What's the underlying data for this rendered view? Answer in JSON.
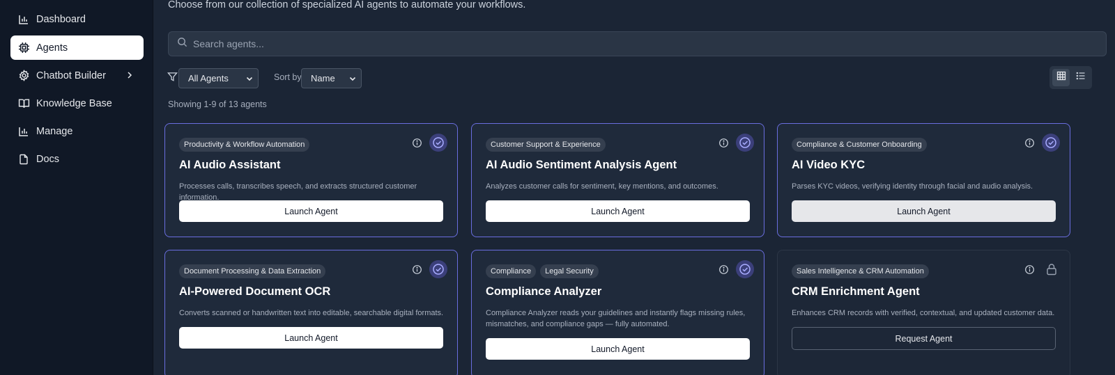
{
  "sidebar": {
    "items": [
      {
        "label": "Dashboard",
        "icon": "bar-chart-icon"
      },
      {
        "label": "Agents",
        "icon": "cpu-icon",
        "active": true
      },
      {
        "label": "Chatbot Builder",
        "icon": "gear-icon"
      },
      {
        "label": "Knowledge Base",
        "icon": "book-icon"
      },
      {
        "label": "Manage",
        "icon": "bar-chart-icon"
      },
      {
        "label": "Docs",
        "icon": "file-icon"
      }
    ]
  },
  "header": {
    "subtitle": "Choose from our collection of specialized AI agents to automate your workflows."
  },
  "search": {
    "placeholder": "Search agents..."
  },
  "filters": {
    "category_value": "All Agents",
    "sort_label": "Sort by:",
    "sort_value": "Name",
    "showing": "Showing 1-9 of 13 agents"
  },
  "agents": [
    {
      "tags": [
        "Productivity & Workflow Automation"
      ],
      "title": "AI Audio Assistant",
      "description": "Processes calls, transcribes speech, and extracts structured customer information.",
      "button": "Launch Agent",
      "status": "enabled"
    },
    {
      "tags": [
        "Customer Support & Experience"
      ],
      "title": "AI Audio Sentiment Analysis Agent",
      "description": "Analyzes customer calls for sentiment, key mentions, and outcomes.",
      "button": "Launch Agent",
      "status": "enabled"
    },
    {
      "tags": [
        "Compliance & Customer Onboarding"
      ],
      "title": "AI Video KYC",
      "description": "Parses KYC videos, verifying identity through facial and audio analysis.",
      "button": "Launch Agent",
      "status": "enabled"
    },
    {
      "tags": [
        "Document Processing & Data Extraction"
      ],
      "title": "AI-Powered Document OCR",
      "description": "Converts scanned or handwritten text into editable, searchable digital formats.",
      "button": "Launch Agent",
      "status": "enabled"
    },
    {
      "tags": [
        "Compliance",
        "Legal Security"
      ],
      "title": "Compliance Analyzer",
      "description": "Compliance Analyzer reads your guidelines and instantly flags missing rules, mismatches, and compliance gaps — fully automated.",
      "button": "Launch Agent",
      "status": "enabled"
    },
    {
      "tags": [
        "Sales Intelligence & CRM Automation"
      ],
      "title": "CRM Enrichment Agent",
      "description": "Enhances CRM records with verified, contextual, and updated customer data.",
      "button": "Request Agent",
      "status": "locked"
    }
  ]
}
